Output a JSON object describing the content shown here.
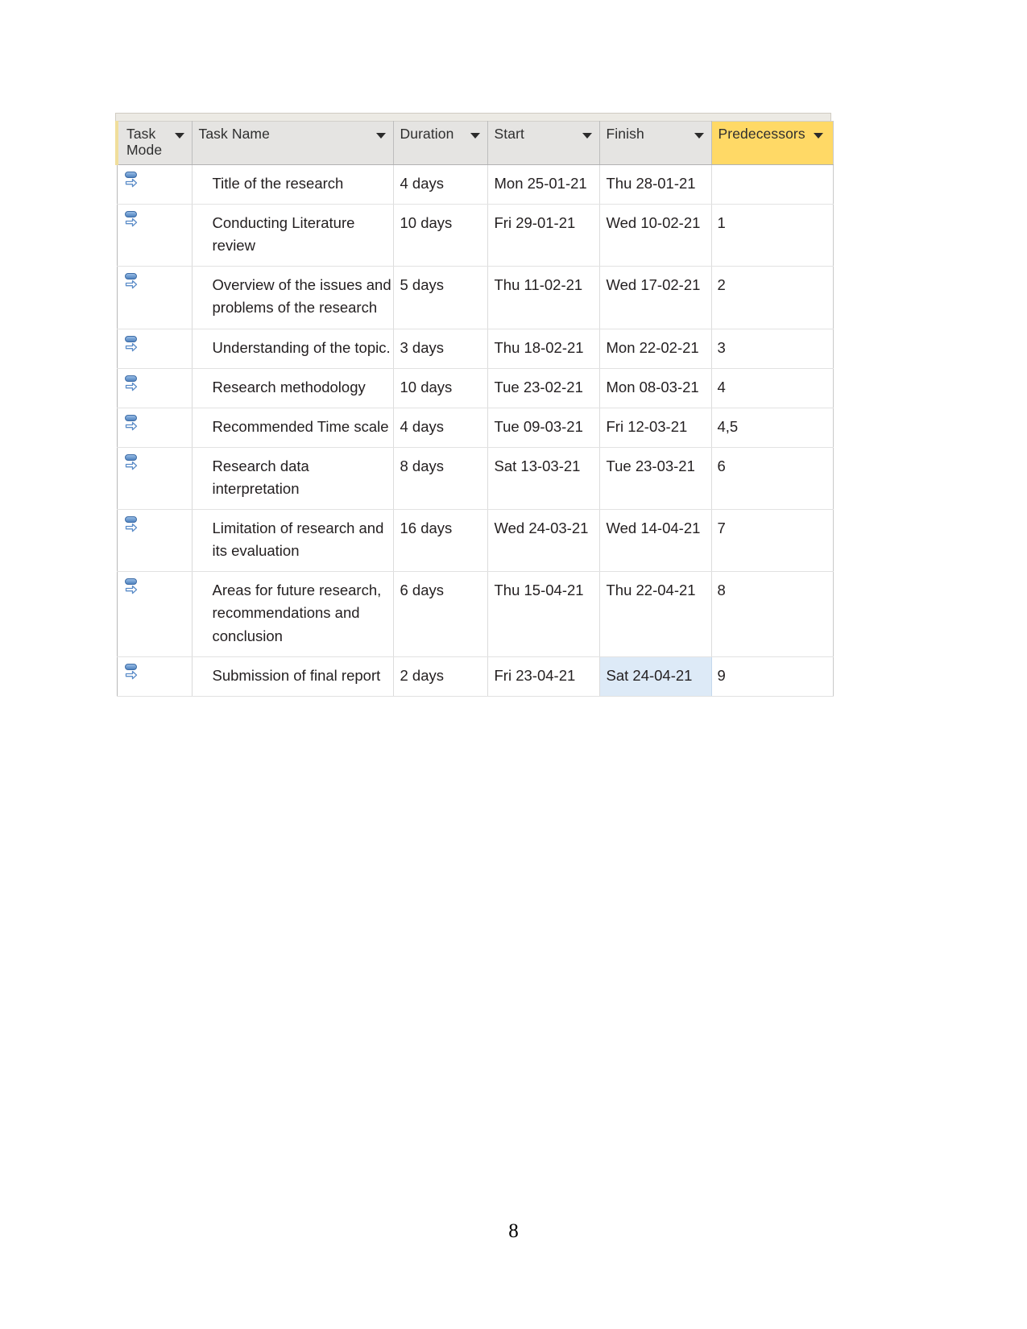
{
  "document": {
    "page_number": "8"
  },
  "gantt": {
    "columns": [
      {
        "key": "task_mode",
        "label": "Task Mode",
        "has_filter": true,
        "highlighted": false
      },
      {
        "key": "task_name",
        "label": "Task Name",
        "has_filter": true,
        "highlighted": false
      },
      {
        "key": "duration",
        "label": "Duration",
        "has_filter": true,
        "highlighted": false
      },
      {
        "key": "start",
        "label": "Start",
        "has_filter": true,
        "highlighted": false
      },
      {
        "key": "finish",
        "label": "Finish",
        "has_filter": true,
        "highlighted": false
      },
      {
        "key": "predecessors",
        "label": "Predecessors",
        "has_filter": true,
        "highlighted": true
      }
    ],
    "header_highlight_color": "#ffd966",
    "selection_color": "#ddeaf7",
    "task_mode_icon": "manually-scheduled-icon",
    "selected_cell": {
      "row": 9,
      "column": "finish"
    },
    "rows": [
      {
        "task_mode": "manually-scheduled-icon",
        "task_name": "Title of the research",
        "duration": "4 days",
        "start": "Mon 25-01-21",
        "finish": "Thu 28-01-21",
        "predecessors": ""
      },
      {
        "task_mode": "manually-scheduled-icon",
        "task_name": "Conducting Literature review",
        "duration": "10 days",
        "start": "Fri 29-01-21",
        "finish": "Wed 10-02-21",
        "predecessors": "1"
      },
      {
        "task_mode": "manually-scheduled-icon",
        "task_name": "Overview of the issues and problems of the research",
        "duration": "5 days",
        "start": "Thu 11-02-21",
        "finish": "Wed 17-02-21",
        "predecessors": "2"
      },
      {
        "task_mode": "manually-scheduled-icon",
        "task_name": "Understanding of the topic.",
        "duration": "3 days",
        "start": "Thu 18-02-21",
        "finish": "Mon 22-02-21",
        "predecessors": "3"
      },
      {
        "task_mode": "manually-scheduled-icon",
        "task_name": "Research methodology",
        "duration": "10 days",
        "start": "Tue 23-02-21",
        "finish": "Mon 08-03-21",
        "predecessors": "4"
      },
      {
        "task_mode": "manually-scheduled-icon",
        "task_name": "Recommended Time scale",
        "duration": "4 days",
        "start": "Tue 09-03-21",
        "finish": "Fri 12-03-21",
        "predecessors": "4,5"
      },
      {
        "task_mode": "manually-scheduled-icon",
        "task_name": "Research data interpretation",
        "duration": "8 days",
        "start": "Sat 13-03-21",
        "finish": "Tue 23-03-21",
        "predecessors": "6"
      },
      {
        "task_mode": "manually-scheduled-icon",
        "task_name": "Limitation of research and its evaluation",
        "duration": "16 days",
        "start": "Wed 24-03-21",
        "finish": "Wed 14-04-21",
        "predecessors": "7"
      },
      {
        "task_mode": "manually-scheduled-icon",
        "task_name": "Areas for future research, recommendations and conclusion",
        "duration": "6 days",
        "start": "Thu 15-04-21",
        "finish": "Thu 22-04-21",
        "predecessors": "8"
      },
      {
        "task_mode": "manually-scheduled-icon",
        "task_name": "Submission of final report",
        "duration": "2 days",
        "start": "Fri 23-04-21",
        "finish": "Sat 24-04-21",
        "predecessors": "9"
      }
    ]
  }
}
